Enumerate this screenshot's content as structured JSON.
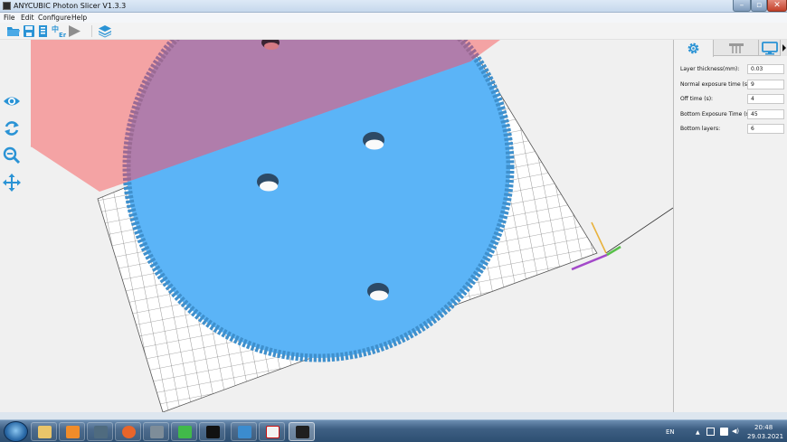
{
  "window": {
    "title": "ANYCUBIC Photon Slicer V1.3.3"
  },
  "menu": [
    "File",
    "Edit",
    "Configure",
    "Help"
  ],
  "toolbar": {
    "icons": [
      "open-folder-icon",
      "save-icon",
      "export-icon",
      "translate-icon",
      "slice-arrow-icon",
      "layers-icon"
    ]
  },
  "left_tools": {
    "icons": [
      "eye-icon",
      "rotate-icon",
      "zoom-icon",
      "move-icon"
    ]
  },
  "right_panel": {
    "tabs": [
      "gear-icon",
      "support-icon",
      "monitor-icon"
    ],
    "active_tab": "gear-icon",
    "fields": [
      {
        "label": "Layer thickness(mm):",
        "value": "0.03"
      },
      {
        "label": "Normal exposure time (s):",
        "value": "9"
      },
      {
        "label": "Off time (s):",
        "value": "4"
      },
      {
        "label": "Bottom Exposure Time (s):",
        "value": "45"
      },
      {
        "label": "Bottom layers:",
        "value": "6"
      }
    ]
  },
  "taskbar": {
    "apps": [
      "explorer",
      "media-player",
      "dev-tools",
      "firefox",
      "settings",
      "qt",
      "terminal",
      "cross-app",
      "pdf-reader",
      "photon-slicer"
    ],
    "active_app": "photon-slicer",
    "language": "EN",
    "clock_time": "20:48",
    "clock_date": "29.03.2021"
  },
  "colors": {
    "model": "#5bb4f7",
    "build_volume": "#f4a3a4",
    "overlap": "#b07dab",
    "accent": "#2a93d5"
  }
}
